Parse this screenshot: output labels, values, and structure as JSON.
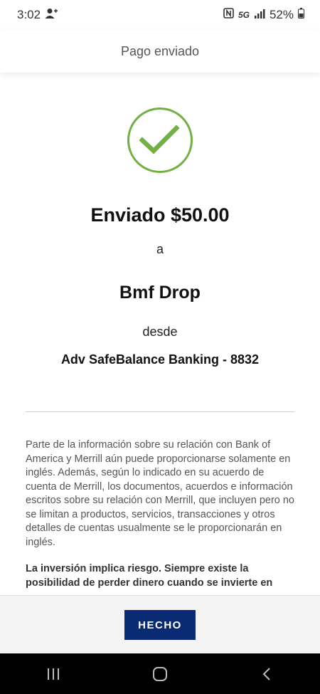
{
  "status_bar": {
    "time": "3:02",
    "network": "5G",
    "battery": "52%",
    "icons": [
      "person-add-icon",
      "nfc-icon",
      "signal-icon",
      "battery-icon"
    ]
  },
  "header": {
    "title": "Pago enviado"
  },
  "confirmation": {
    "icon": "checkmark-circle-icon",
    "amount_text": "Enviado $50.00",
    "to_word": "a",
    "recipient": "Bmf Drop",
    "from_word": "desde",
    "account": "Adv SafeBalance Banking - 8832"
  },
  "disclaimer": {
    "text": "Parte de la información sobre su relación con Bank of America y Merrill aún puede proporcionarse solamente en inglés. Además, según lo indicado en su acuerdo de cuenta de Merrill, los documentos, acuerdos e información escritos sobre su relación con Merrill, que incluyen pero no se limitan a productos, servicios, transacciones y otros detalles de cuentas usualmente se le proporcionarán en inglés.",
    "risk_text": "La inversión implica riesgo. Siempre existe la posibilidad de perder dinero cuando se invierte en"
  },
  "footer": {
    "done_label": "HECHO"
  },
  "nav": {
    "icons": [
      "recent-apps-icon",
      "home-icon",
      "back-icon"
    ]
  },
  "colors": {
    "check": "#72b043",
    "primary_button": "#0a2a73"
  }
}
